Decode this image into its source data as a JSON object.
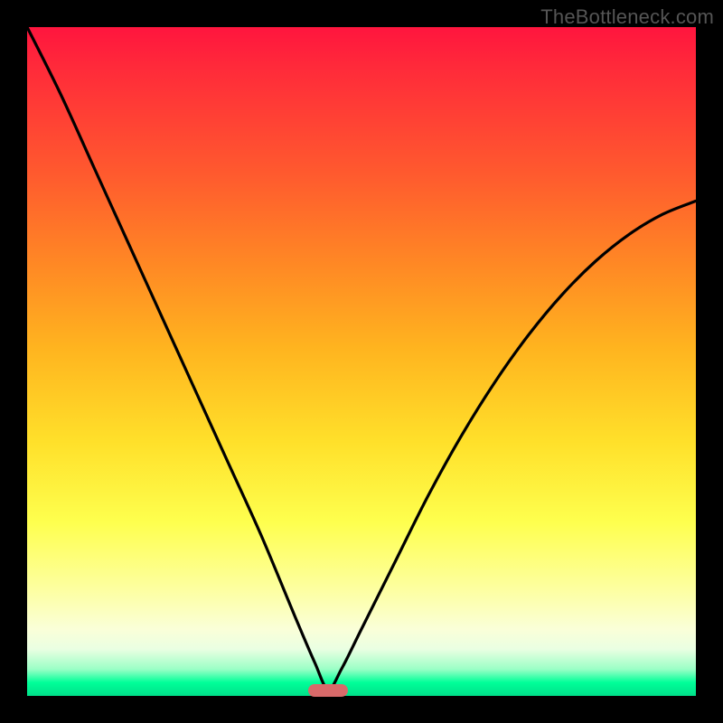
{
  "watermark": "TheBottleneck.com",
  "colors": {
    "frame": "#000000",
    "curve": "#000000",
    "marker": "#d86a6a",
    "gradient_top": "#ff153e",
    "gradient_bottom": "#00e089"
  },
  "chart_data": {
    "type": "line",
    "title": "",
    "xlabel": "",
    "ylabel": "",
    "xlim": [
      0,
      100
    ],
    "ylim": [
      0,
      100
    ],
    "grid": false,
    "legend": false,
    "annotations": [],
    "series": [
      {
        "name": "bottleneck-curve",
        "description": "V-shaped curve; y is bottleneck percentage, minimum (~0) near x≈45, rising steeply on both sides.",
        "x": [
          0,
          5,
          10,
          15,
          20,
          25,
          30,
          35,
          40,
          43,
          45,
          47,
          50,
          55,
          60,
          65,
          70,
          75,
          80,
          85,
          90,
          95,
          100
        ],
        "values": [
          100,
          90,
          79,
          68,
          57,
          46,
          35,
          24,
          12,
          5,
          1,
          4,
          10,
          20,
          30,
          39,
          47,
          54,
          60,
          65,
          69,
          72,
          74
        ]
      }
    ],
    "marker": {
      "x_center": 45,
      "x_width": 6,
      "y": 0,
      "note": "optimal/no-bottleneck zone indicator at bottom"
    }
  }
}
